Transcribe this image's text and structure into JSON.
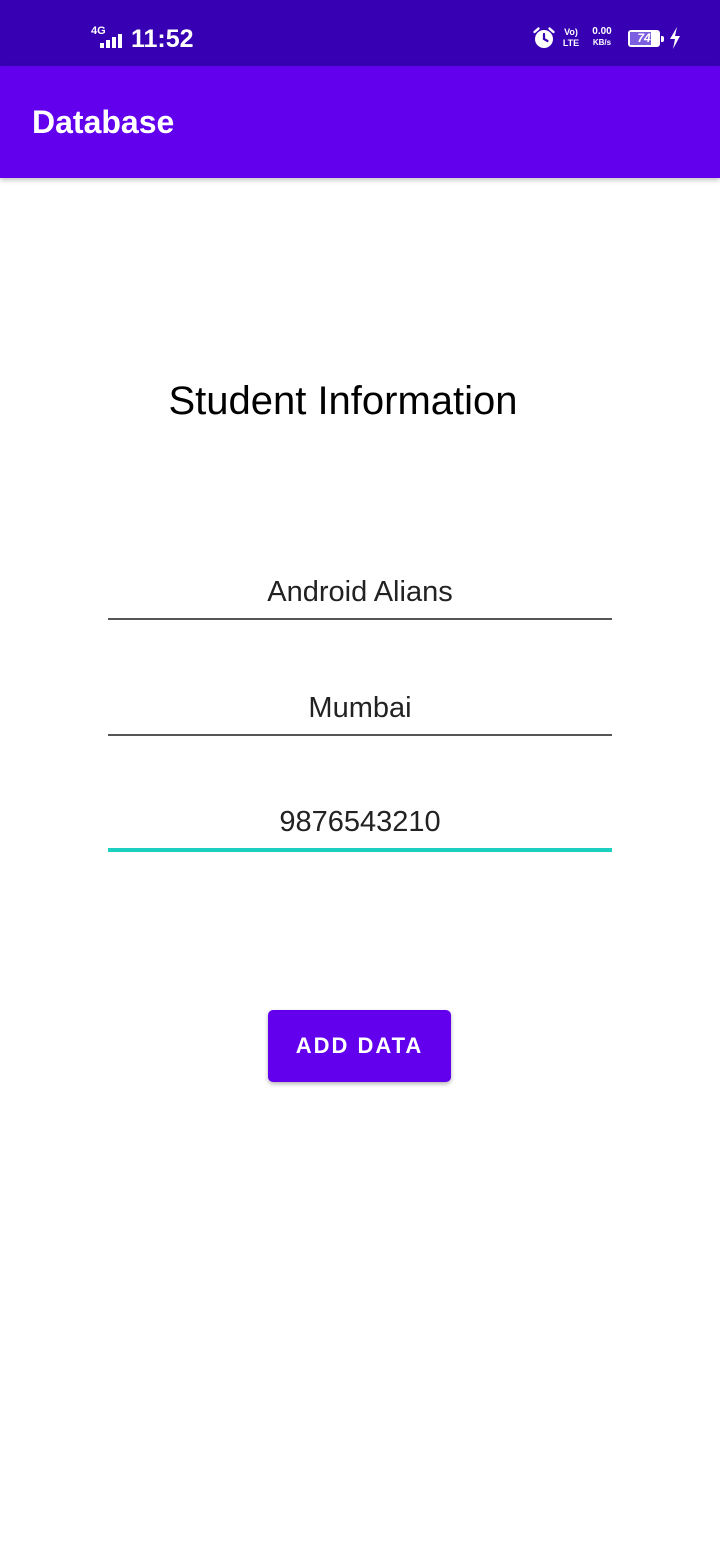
{
  "status_bar": {
    "network_type": "4G",
    "time": "11:52",
    "volte_top": "Vo)",
    "volte_bottom": "LTE",
    "speed_value": "0.00",
    "speed_unit": "KB/s",
    "battery_level": "74",
    "battery_fraction": 0.74,
    "icons": {
      "signal": "signal-bars-icon",
      "alarm": "alarm-clock-icon",
      "battery": "battery-icon",
      "charging": "charging-bolt-icon"
    },
    "background_color": "#3700b3"
  },
  "app_bar": {
    "title": "Database",
    "background_color": "#6200ee"
  },
  "main": {
    "heading": "Student Information",
    "fields": {
      "name": {
        "value": "Android Alians"
      },
      "city": {
        "value": "Mumbai"
      },
      "phone": {
        "value": "9876543210",
        "focused": true
      }
    },
    "add_button_label": "ADD DATA"
  },
  "colors": {
    "accent": "#1ccfbf",
    "primary": "#6200ee"
  }
}
